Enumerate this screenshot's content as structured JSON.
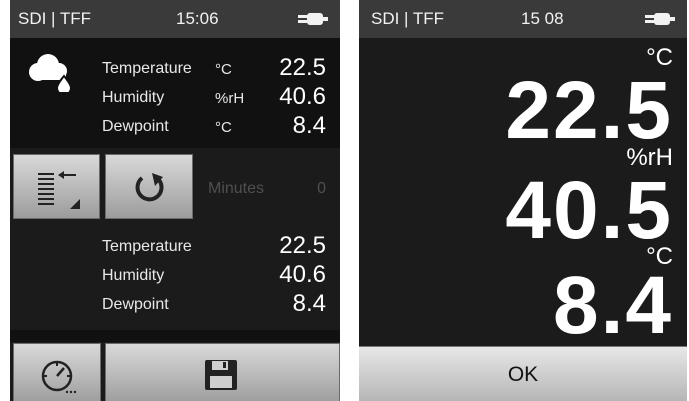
{
  "left": {
    "status": {
      "title": "SDI | TFF",
      "time": "15:06",
      "icon": "plug-icon"
    },
    "current": {
      "rows": [
        {
          "label": "Temperature",
          "unit": "°C",
          "value": "22.5"
        },
        {
          "label": "Humidity",
          "unit": "%rH",
          "value": "40.6"
        },
        {
          "label": "Dewpoint",
          "unit": "°C",
          "value": "8.4"
        }
      ]
    },
    "controls": {
      "minutes_label": "Minutes",
      "minutes_value": "0"
    },
    "logged": {
      "rows": [
        {
          "label": "Temperature",
          "value": "22.5"
        },
        {
          "label": "Humidity",
          "value": "40.6"
        },
        {
          "label": "Dewpoint",
          "value": "8.4"
        }
      ]
    }
  },
  "right": {
    "status": {
      "title": "SDI | TFF",
      "time": "15 08",
      "icon": "plug-icon"
    },
    "readings": [
      {
        "unit": "°C",
        "value": "22.5"
      },
      {
        "unit": "%rH",
        "value": "40.5"
      },
      {
        "unit": "°C",
        "value": "8.4"
      }
    ],
    "ok_label": "OK"
  }
}
